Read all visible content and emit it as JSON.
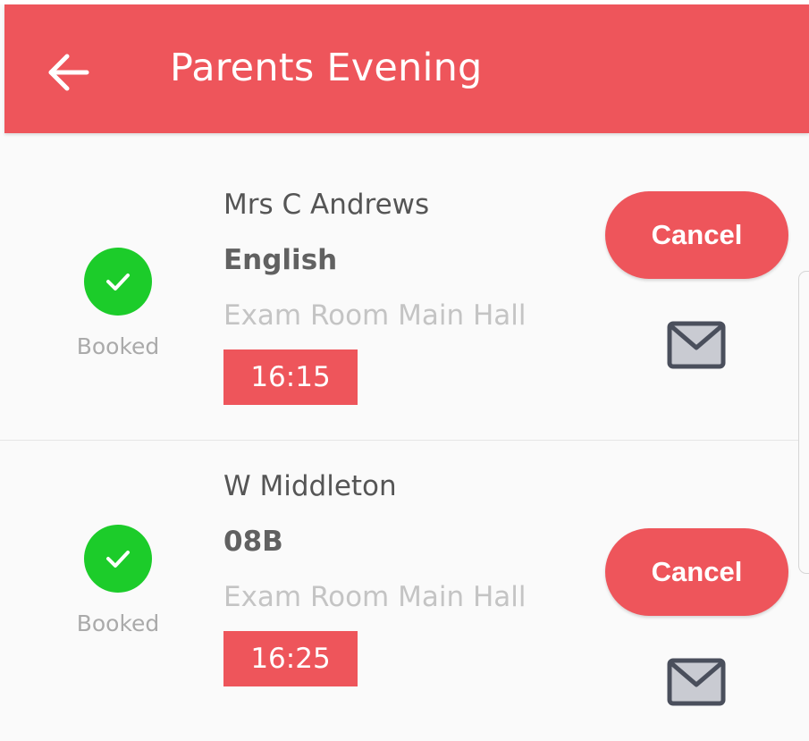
{
  "header": {
    "title": "Parents Evening",
    "back_icon": "arrow-left-icon",
    "background_color": "#ee555b"
  },
  "appointments": [
    {
      "teacher": "Mrs C Andrews",
      "subject": "English",
      "location": "Exam Room Main Hall",
      "time": "16:15",
      "status": "Booked",
      "status_icon": "check-circle-icon",
      "cancel_label": "Cancel",
      "mail_icon": "envelope-icon"
    },
    {
      "teacher": "W Middleton",
      "subject": "08B",
      "location": "Exam Room Main Hall",
      "time": "16:25",
      "status": "Booked",
      "status_icon": "check-circle-icon",
      "cancel_label": "Cancel",
      "mail_icon": "envelope-icon"
    }
  ],
  "colors": {
    "accent": "#ee555b",
    "booked_green": "#1ccc2a"
  }
}
